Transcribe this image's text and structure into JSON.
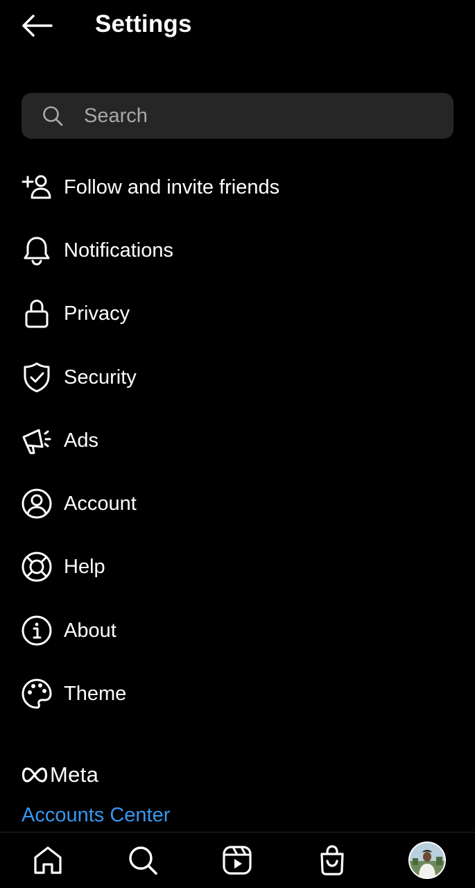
{
  "header": {
    "title": "Settings",
    "back_icon": "arrow-left-icon"
  },
  "search": {
    "placeholder": "Search",
    "value": "",
    "icon": "search-icon"
  },
  "menu": {
    "items": [
      {
        "label": "Follow and invite friends",
        "icon": "add-person-icon"
      },
      {
        "label": "Notifications",
        "icon": "bell-icon"
      },
      {
        "label": "Privacy",
        "icon": "lock-icon"
      },
      {
        "label": "Security",
        "icon": "shield-check-icon"
      },
      {
        "label": "Ads",
        "icon": "megaphone-icon"
      },
      {
        "label": "Account",
        "icon": "user-circle-icon"
      },
      {
        "label": "Help",
        "icon": "lifebuoy-icon"
      },
      {
        "label": "About",
        "icon": "info-icon"
      },
      {
        "label": "Theme",
        "icon": "palette-icon"
      }
    ]
  },
  "footer": {
    "brand": "Meta",
    "brand_icon": "meta-infinity-icon",
    "accounts_center": "Accounts Center"
  },
  "bottom_nav": {
    "items": [
      {
        "icon": "home-icon"
      },
      {
        "icon": "search-icon"
      },
      {
        "icon": "reels-icon"
      },
      {
        "icon": "shopping-bag-icon"
      },
      {
        "icon": "profile-avatar"
      }
    ]
  },
  "colors": {
    "background": "#000000",
    "search_background": "#262626",
    "text": "#ffffff",
    "placeholder": "#a8a8a8",
    "link": "#3797f0"
  }
}
